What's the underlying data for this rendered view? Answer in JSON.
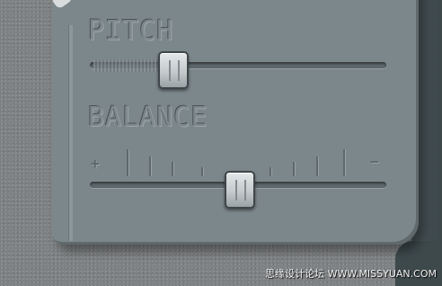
{
  "pitch": {
    "label": "PITCH",
    "slider_value": 0.24
  },
  "balance": {
    "label": "BALANCE",
    "slider_value": 0.5,
    "left_symbol": "+",
    "right_symbol": "−"
  },
  "watermark": "思缘设计论坛 WWW.MISSYUAN.COM",
  "colors": {
    "panel": "#7c878b",
    "background": "#7f8284",
    "thumb": "#c5cbcd"
  }
}
